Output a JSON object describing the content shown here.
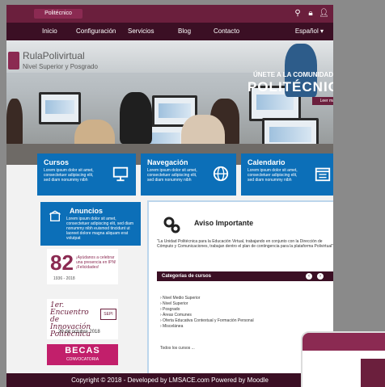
{
  "colors": {
    "brand": "#6b1f3d",
    "nav": "#3b0f24",
    "accent_blue": "#0c6fb8",
    "promo_pink": "#c21f6b"
  },
  "topbar": {
    "logo_text": "Politécnico",
    "icons": [
      "search-icon",
      "lock-icon",
      "user-icon"
    ]
  },
  "nav": {
    "items": [
      "Inicio",
      "Configuración",
      "Servicios",
      "Blog",
      "Contacto"
    ],
    "language": "Español ▾"
  },
  "hero": {
    "brand_name": "RulaPolivirtual",
    "brand_sub": "Nivel Superior y Posgrado",
    "join_text": "ÚNETE A LA COMUNIDAD",
    "title": "POLITÉCNICA",
    "button": "Leer más"
  },
  "cards": [
    {
      "title": "Cursos",
      "body": "Lorem ipsum dolor sit amet, consectetuer adipiscing elit, sed diam nonummy nibh",
      "icon": "presentation-icon"
    },
    {
      "title": "Navegación",
      "body": "Lorem ipsum dolor sit amet, consectetuer adipiscing elit, sed diam nonummy nibh",
      "icon": "globe-icon"
    },
    {
      "title": "Calendario",
      "body": "Lorem ipsum dolor sit amet, consectetuer adipiscing elit, sed diam nonummy nibh",
      "icon": "calendar-icon"
    }
  ],
  "anuncios": {
    "title": "Anuncios",
    "body": "Lorem ipsum dolor sit amet, consectetuer adipiscing elit, sed diam nonummy nibh euismod tincidunt ut laoreet dolore magna aliquam erat volutpat"
  },
  "banners": {
    "b1_num": "82",
    "b1_text": "¡Ayúdanos a celebrar una presencia en IPN! ¡Felicidades!",
    "b1_fecha": "1936 - 2018",
    "b2_title": "1er. Encuentro de Innovación Politécnica",
    "b2_date": "29 de octubre 2018",
    "b2_logo": "SEPI",
    "b3_title": "BECAS",
    "b3_sub": "CONVOCATORIA"
  },
  "main": {
    "title": "Aviso Importante",
    "body": "\"La Unidad Politécnica para la Educación Virtual, trabajando en conjunto con la Dirección de Cómputo y Comunicaciones, trabajan dentro el plan de contingencia para la plataforma Polivirtual\"",
    "categories_label": "Categorías de cursos",
    "categories": [
      "› Nivel Medio Superior",
      "› Nivel Superior",
      "› Posgrado",
      "› Áreas Comunes",
      "› Oferta Educativa Contextual y Formación Personal",
      "› Miscelánea"
    ],
    "all_categories": "Todos los cursos ..."
  },
  "footer": {
    "text": "Copyright © 2018 - Developed by LMSACE.com Powered by Moodle"
  }
}
